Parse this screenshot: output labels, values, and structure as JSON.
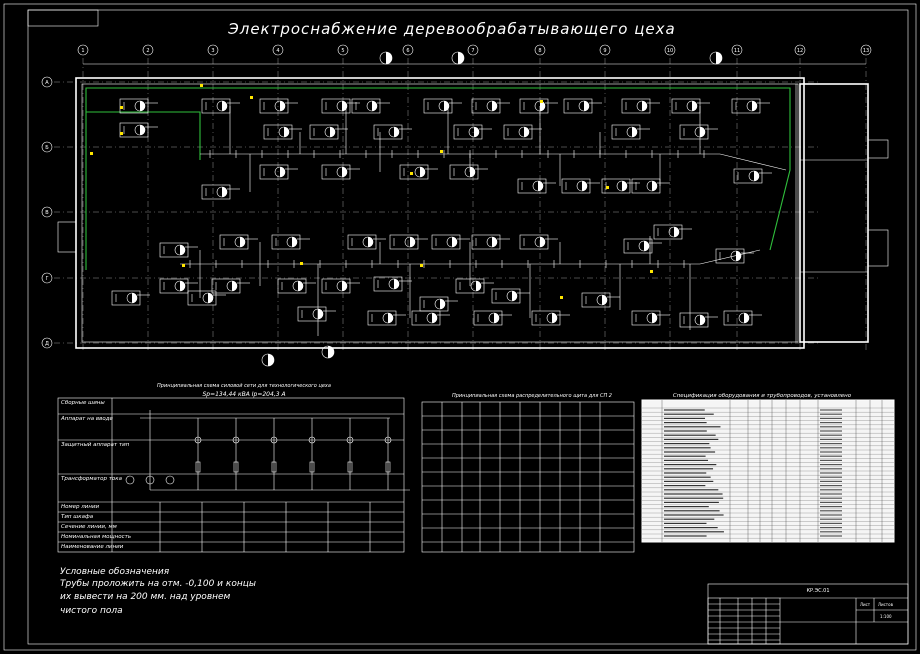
{
  "title": "Электроснабжение деревообрабатывающего цеха",
  "grid_columns": [
    "1",
    "2",
    "3",
    "4",
    "5",
    "6",
    "7",
    "8",
    "9",
    "10",
    "11",
    "12",
    "13"
  ],
  "grid_rows": [
    "А",
    "Б",
    "В",
    "Г",
    "Д"
  ],
  "left_table_rows": [
    "Сборные шины",
    "Аппарат на вводе",
    "Защитный аппарат тип",
    "Трансформатор тока",
    "Номер линии",
    "Тип шкафа",
    "Сечение линии, мм",
    "Номинальная мощность",
    "Наименование линии"
  ],
  "legend": {
    "heading": "Условные обозначения",
    "lines": [
      "Трубы проложить на отм. -0,100 и концы",
      "их вывести на 200 мм. над уровнем",
      "чистого пола"
    ]
  },
  "scheme1_title": "Принципиальная схема силовой сети для технологического цеха",
  "scheme1_sub": "Sр=134,44 кВА   Iр=204,3 А",
  "scheme2_title": "Принципиальная схема распределительного щита для СП 2",
  "spec_title": "Спецификация оборудования и трубопроводов, установлено",
  "title_block": {
    "sheet": "Лист",
    "sheets": "Листов",
    "doc": "КР.ЭС.01",
    "scale": "1:100"
  }
}
